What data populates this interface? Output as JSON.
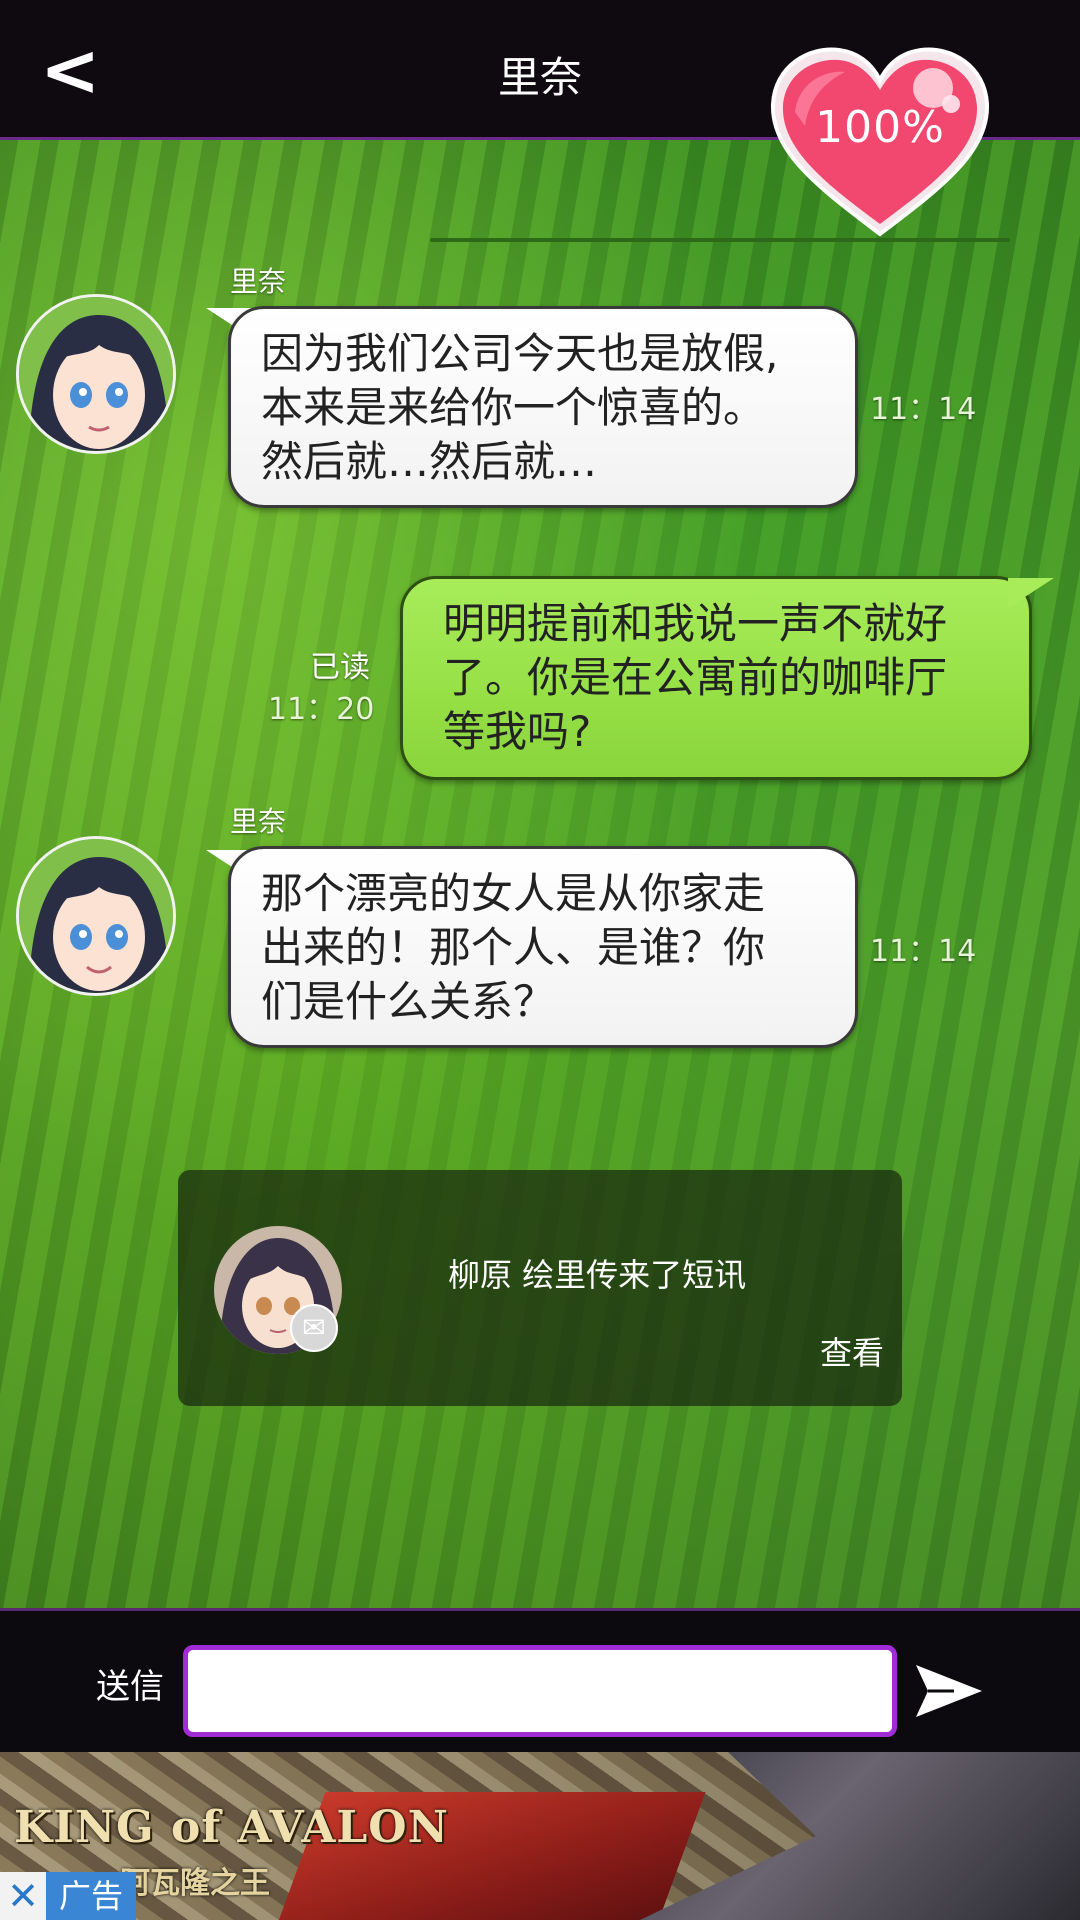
{
  "header": {
    "back_label": "<",
    "title": "里奈",
    "affection": "100%"
  },
  "messages": [
    {
      "sender": "里奈",
      "lines": [
        "因为我们公司今天也是放假,",
        "本来是来给你一个惊喜的。",
        "然后就…然后就…"
      ],
      "time": "11：14"
    },
    {
      "read_label": "已读",
      "time": "11：20",
      "lines": [
        "明明提前和我说一声不就好",
        "了。你是在公寓前的咖啡厅",
        "等我吗?"
      ]
    },
    {
      "sender": "里奈",
      "lines": [
        "那个漂亮的女人是从你家走",
        "出来的！那个人、是谁？你",
        "们是什么关系？"
      ],
      "time": "11：14"
    }
  ],
  "notice": {
    "text": "柳原 绘里传来了短讯",
    "view_label": "查看"
  },
  "send_bar": {
    "label": "送信",
    "input_value": ""
  },
  "ad": {
    "logo": "KING of AVALON",
    "logo_sub": "阿瓦隆之王",
    "close_label": "✕",
    "tag": "广告"
  },
  "colors": {
    "header_bg": "#0f0a10",
    "accent_purple": "#a12bd6",
    "heart_pink": "#f2476e",
    "bubble_out_green": "#9fe650",
    "ad_tag_blue": "#3a86d4"
  }
}
